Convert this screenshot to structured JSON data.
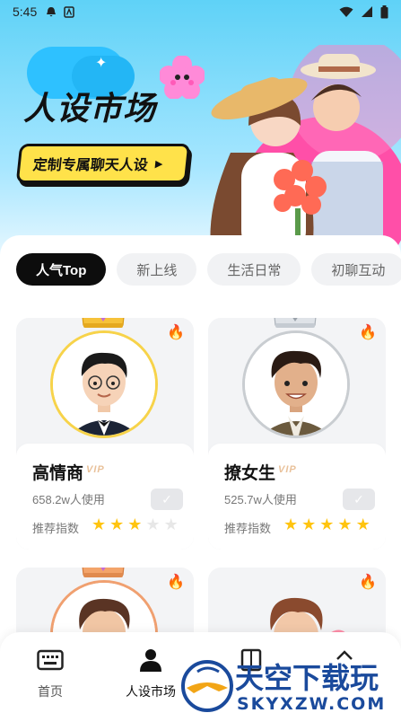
{
  "status_bar": {
    "time": "5:45"
  },
  "hero": {
    "title": "人设市场",
    "cta_label": "定制专属聊天人设"
  },
  "tabs": [
    {
      "label": "人气Top",
      "active": true
    },
    {
      "label": "新上线",
      "active": false
    },
    {
      "label": "生活日常",
      "active": false
    },
    {
      "label": "初聊互动",
      "active": false
    }
  ],
  "cards": [
    {
      "name": "高情商",
      "badge": "VIP",
      "usage": "658.2w人使用",
      "rec_label": "推荐指数",
      "rating": 3,
      "rating_max": 5,
      "crown": "gold"
    },
    {
      "name": "撩女生",
      "badge": "VIP",
      "usage": "525.7w人使用",
      "rec_label": "推荐指数",
      "rating": 5,
      "rating_max": 5,
      "crown": "silver"
    },
    {
      "name": "",
      "crown": "bronze"
    },
    {
      "name": ""
    }
  ],
  "bottom_nav": [
    {
      "label": "首页",
      "icon": "keyboard-icon",
      "active": false
    },
    {
      "label": "人设市场",
      "icon": "person-icon",
      "active": true
    },
    {
      "label": "",
      "icon": "book-icon",
      "active": false
    },
    {
      "label": "",
      "icon": "user-icon",
      "active": false
    }
  ],
  "watermark": {
    "brand": "天空下载玩",
    "domain": "SKYXZW.COM"
  },
  "colors": {
    "accent_yellow": "#ffe24a",
    "tab_active": "#0d0d0d",
    "star": "#ffc40f",
    "hero_blue": "#5fd2f7"
  }
}
